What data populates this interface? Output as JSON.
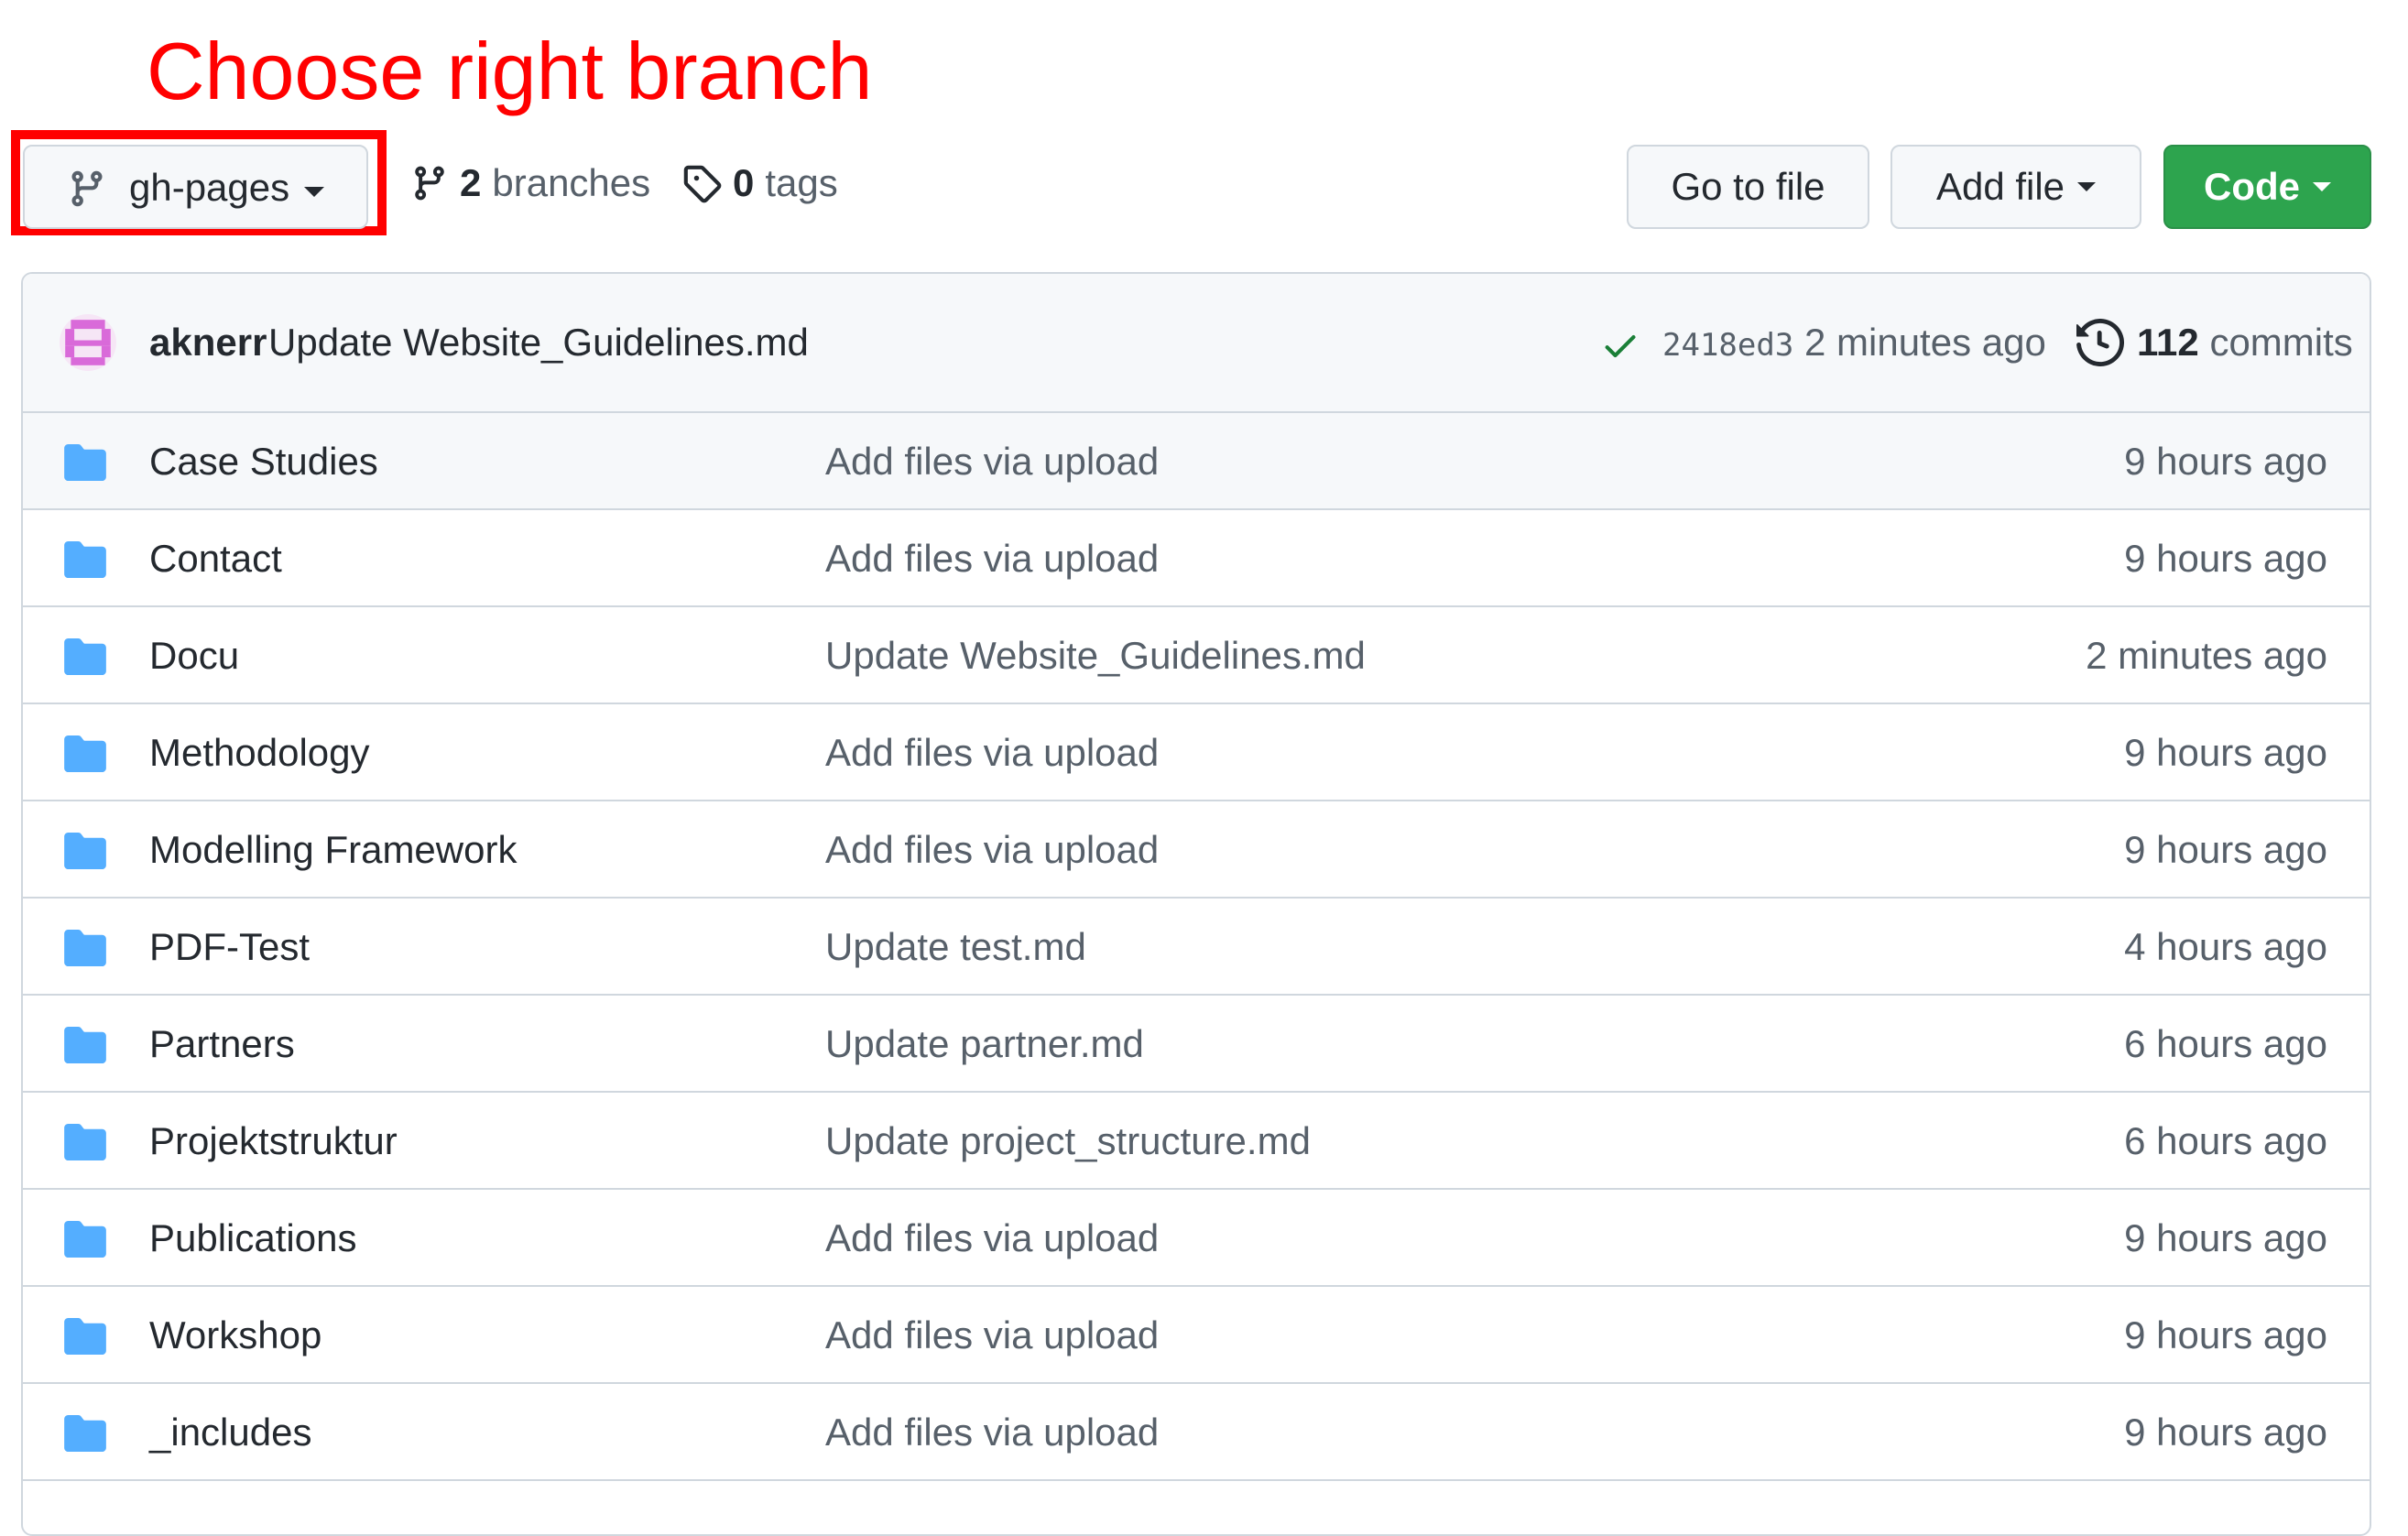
{
  "annotation": {
    "text": "Choose right branch",
    "color": "#ff0000"
  },
  "branch_selector": {
    "label": "gh-pages"
  },
  "branches": {
    "count": "2",
    "label": "branches"
  },
  "tags": {
    "count": "0",
    "label": "tags"
  },
  "buttons": {
    "go_to_file": "Go to file",
    "add_file": "Add file",
    "code": "Code"
  },
  "colors": {
    "code_button": "#2da44e",
    "folder": "#54aeff",
    "check": "#1a7f37"
  },
  "latest_commit": {
    "author": "aknerr",
    "message": "Update Website_Guidelines.md",
    "sha": "2418ed3",
    "time": "2 minutes ago",
    "count": "112",
    "count_label": "commits"
  },
  "files": [
    {
      "name": "Case Studies",
      "message": "Add files via upload",
      "time": "9 hours ago",
      "icon": "folder-icon"
    },
    {
      "name": "Contact",
      "message": "Add files via upload",
      "time": "9 hours ago",
      "icon": "folder-icon"
    },
    {
      "name": "Docu",
      "message": "Update Website_Guidelines.md",
      "time": "2 minutes ago",
      "icon": "folder-icon"
    },
    {
      "name": "Methodology",
      "message": "Add files via upload",
      "time": "9 hours ago",
      "icon": "folder-icon"
    },
    {
      "name": "Modelling Framework",
      "message": "Add files via upload",
      "time": "9 hours ago",
      "icon": "folder-icon"
    },
    {
      "name": "PDF-Test",
      "message": "Update test.md",
      "time": "4 hours ago",
      "icon": "folder-icon"
    },
    {
      "name": "Partners",
      "message": "Update partner.md",
      "time": "6 hours ago",
      "icon": "folder-icon"
    },
    {
      "name": "Projektstruktur",
      "message": "Update project_structure.md",
      "time": "6 hours ago",
      "icon": "folder-icon"
    },
    {
      "name": "Publications",
      "message": "Add files via upload",
      "time": "9 hours ago",
      "icon": "folder-icon"
    },
    {
      "name": "Workshop",
      "message": "Add files via upload",
      "time": "9 hours ago",
      "icon": "folder-icon"
    },
    {
      "name": "_includes",
      "message": "Add files via upload",
      "time": "9 hours ago",
      "icon": "folder-icon"
    }
  ]
}
